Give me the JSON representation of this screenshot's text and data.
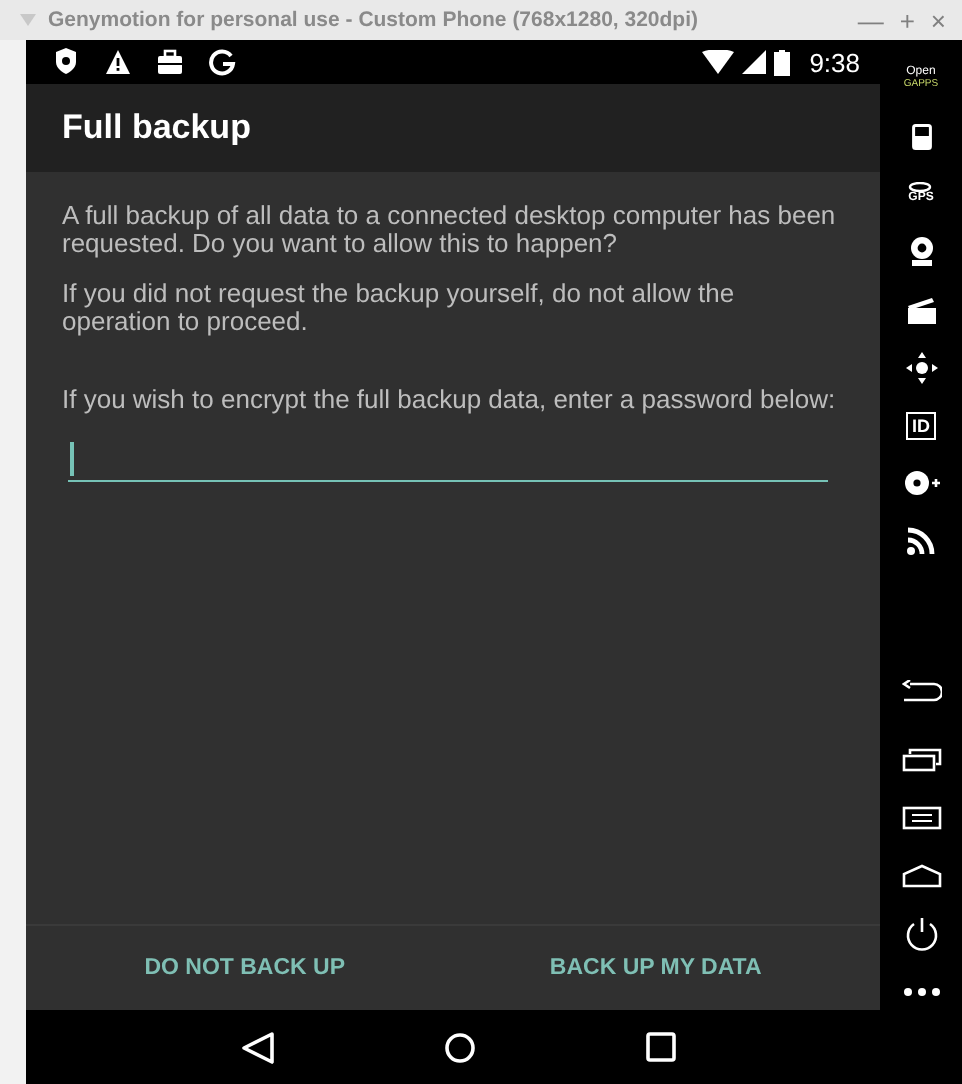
{
  "window": {
    "title": "Genymotion for personal use - Custom Phone (768x1280, 320dpi)",
    "controls": [
      "—",
      "+",
      "×"
    ]
  },
  "status_bar": {
    "icons": [
      {
        "kind": "shield"
      },
      {
        "kind": "warning"
      },
      {
        "kind": "briefcase"
      },
      {
        "kind": "google"
      }
    ],
    "time": "9:38"
  },
  "dialog": {
    "title": "Full backup",
    "paragraphs": [
      "A full backup of all data to a connected desktop computer has been requested. Do you want to allow this to happen?",
      "If you did not request the backup yourself, do not allow the operation to proceed.",
      "If you wish to encrypt the full backup data, enter a password below:"
    ],
    "password": {
      "focused": true
    },
    "buttons": [
      "DO NOT BACK UP",
      "BACK UP MY DATA"
    ]
  },
  "nav_bar": [
    {
      "kind": "back"
    },
    {
      "kind": "home"
    },
    {
      "kind": "recents"
    }
  ],
  "sidebar": {
    "items": [
      {
        "kind": "logo",
        "label": "Open",
        "sublabel": "GAPPS"
      },
      {
        "kind": "battery"
      },
      {
        "kind": "gps",
        "label": "GPS"
      },
      {
        "kind": "webcam"
      },
      {
        "kind": "clapper"
      },
      {
        "kind": "dpad"
      },
      {
        "kind": "id",
        "label": "ID"
      },
      {
        "kind": "disk"
      },
      {
        "kind": "rss"
      },
      {
        "kind": "back"
      },
      {
        "kind": "recents"
      },
      {
        "kind": "menu"
      },
      {
        "kind": "home"
      },
      {
        "kind": "power"
      },
      {
        "kind": "more"
      }
    ]
  }
}
